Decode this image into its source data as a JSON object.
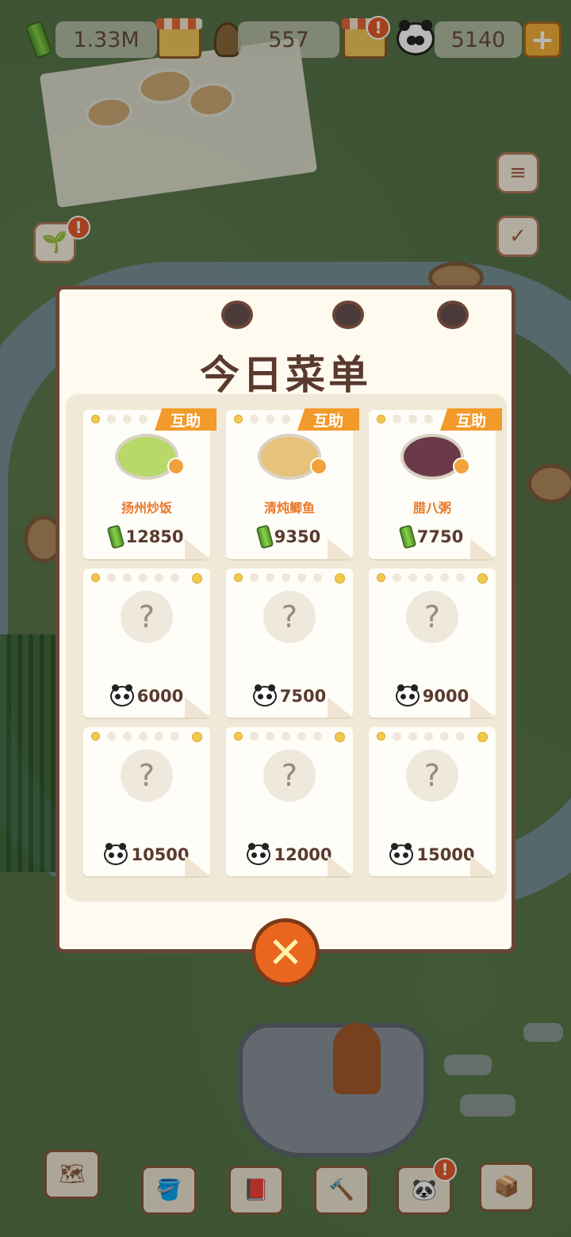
{
  "hud": {
    "bamboo_amount": "1.33M",
    "shoot_amount": "557",
    "panda_amount": "5140",
    "plus_label": "+",
    "alert_symbol": "!"
  },
  "modal": {
    "title": "今日菜单",
    "close_symbol": "✕",
    "help_badge_label": "互助",
    "unknown_symbol": "?",
    "recipes": [
      {
        "name": "扬州炒饭",
        "price": "12850",
        "currency": "bamboo",
        "dish_color": "#b8d86a"
      },
      {
        "name": "清炖鲫鱼",
        "price": "9350",
        "currency": "bamboo",
        "dish_color": "#e6c27a"
      },
      {
        "name": "腊八粥",
        "price": "7750",
        "currency": "bamboo",
        "dish_color": "#6b3a4a"
      }
    ],
    "locked": [
      {
        "price": "6000",
        "currency": "panda"
      },
      {
        "price": "7500",
        "currency": "panda"
      },
      {
        "price": "9000",
        "currency": "panda"
      },
      {
        "price": "10500",
        "currency": "panda"
      },
      {
        "price": "12000",
        "currency": "panda"
      },
      {
        "price": "15000",
        "currency": "panda"
      }
    ]
  },
  "side_buttons": {
    "menu_icon": "≡",
    "calendar_icon": "✓"
  },
  "colors": {
    "accent_orange": "#f29a2a",
    "dish_name_orange": "#e8772a",
    "brown_text": "#5a3a2e"
  }
}
